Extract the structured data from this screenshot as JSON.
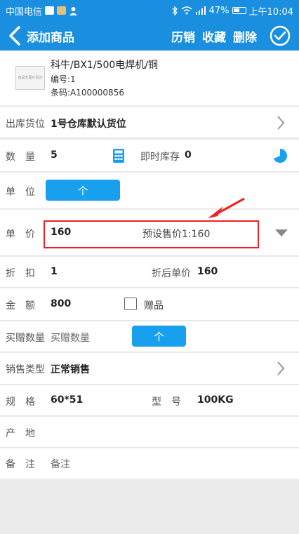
{
  "status": {
    "carrier": "中国电信",
    "battery": "47%",
    "time": "上午10:04"
  },
  "appbar": {
    "title": "添加商品",
    "history_sales": "历销",
    "favorite": "收藏",
    "delete": "删除"
  },
  "product": {
    "thumb_text": "商品无图片显示",
    "name": "科牛/BX1/500电焊机/铜",
    "code": "编号:1",
    "barcode": "条码:A100000856"
  },
  "fields": {
    "location": {
      "label": "出库货位",
      "value": "1号仓库默认货位"
    },
    "quantity": {
      "label": "数　量",
      "value": "5",
      "stock_label": "即时库存",
      "stock_value": "0"
    },
    "unit": {
      "label": "单　位",
      "value": "个"
    },
    "price": {
      "label": "单　价",
      "value": "160",
      "preset": "预设售价1:160"
    },
    "discount": {
      "label": "折　扣",
      "value": "1",
      "after_label": "折后单价",
      "after_value": "160"
    },
    "amount": {
      "label": "金　额",
      "value": "800",
      "gift_label": "赠品"
    },
    "bonus": {
      "label": "买赠数量",
      "placeholder": "买赠数量",
      "unit": "个"
    },
    "sale_type": {
      "label": "销售类型",
      "value": "正常销售"
    },
    "spec": {
      "label": "规　格",
      "value": "60*51",
      "model_label": "型　号",
      "model_value": "100KG"
    },
    "origin": {
      "label": "产　地",
      "value": ""
    },
    "remark": {
      "label": "备　注",
      "placeholder": "备注"
    }
  },
  "colors": {
    "primary": "#1a8fe0",
    "button": "#18a0ef",
    "highlight": "#e22222"
  }
}
